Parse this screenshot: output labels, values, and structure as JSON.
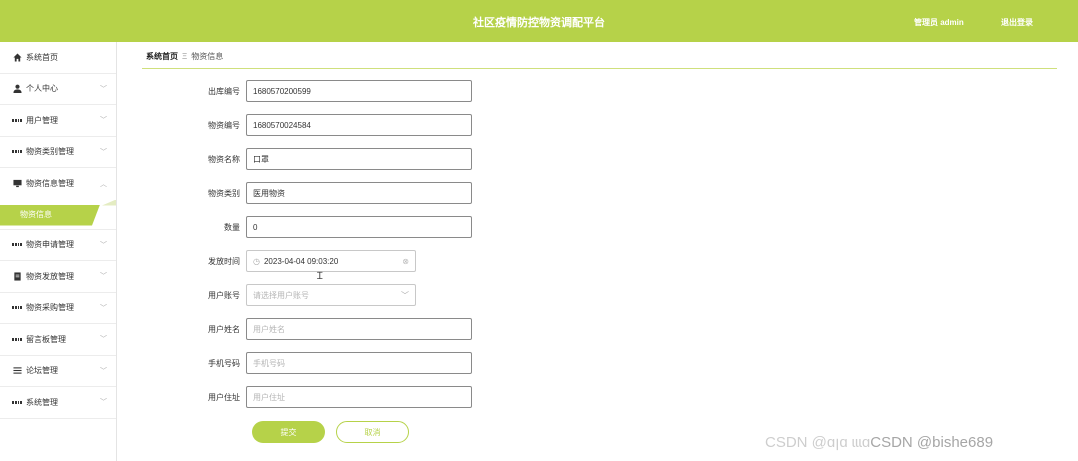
{
  "header": {
    "title": "社区疫情防控物资调配平台",
    "admin": "管理员 admin",
    "logout": "退出登录"
  },
  "sidebar": {
    "items": [
      {
        "label": "系统首页",
        "icon": "home-icon"
      },
      {
        "label": "个人中心",
        "icon": "user-icon"
      },
      {
        "label": "用户管理",
        "icon": "grid-icon"
      },
      {
        "label": "物资类别管理",
        "icon": "grid-icon"
      },
      {
        "label": "物资信息管理",
        "icon": "monitor-icon"
      },
      {
        "label": "物资信息",
        "icon": ""
      },
      {
        "label": "物资申请管理",
        "icon": "grid-icon"
      },
      {
        "label": "物资发放管理",
        "icon": "document-icon"
      },
      {
        "label": "物资采购管理",
        "icon": "grid-icon"
      },
      {
        "label": "留言板管理",
        "icon": "grid-icon"
      },
      {
        "label": "论坛管理",
        "icon": "list-icon"
      },
      {
        "label": "系统管理",
        "icon": "grid-icon"
      }
    ]
  },
  "breadcrumb": {
    "home": "系统首页",
    "current": "物资信息"
  },
  "form": {
    "outbound_no": {
      "label": "出库编号",
      "value": "1680570200599"
    },
    "material_no": {
      "label": "物资编号",
      "value": "1680570024584"
    },
    "material_name": {
      "label": "物资名称",
      "value": "口罩"
    },
    "material_category": {
      "label": "物资类别",
      "value": "医用物资"
    },
    "quantity": {
      "label": "数量",
      "value": "0"
    },
    "issue_time": {
      "label": "发放时间",
      "value": "2023-04-04 09:03:20"
    },
    "user_account": {
      "label": "用户账号",
      "placeholder": "请选择用户账号"
    },
    "user_name": {
      "label": "用户姓名",
      "placeholder": "用户姓名"
    },
    "phone": {
      "label": "手机号码",
      "placeholder": "手机号码"
    },
    "address": {
      "label": "用户住址",
      "placeholder": "用户住址"
    },
    "submit": "提交",
    "cancel": "取消"
  },
  "watermark": {
    "ghost": "CSDN @ɑꞁɑ ɩɩɩɑ",
    "text": "CSDN @bishe689"
  },
  "colors": {
    "accent": "#b6d249",
    "text": "#333333",
    "placeholder": "#b5b5b5"
  }
}
